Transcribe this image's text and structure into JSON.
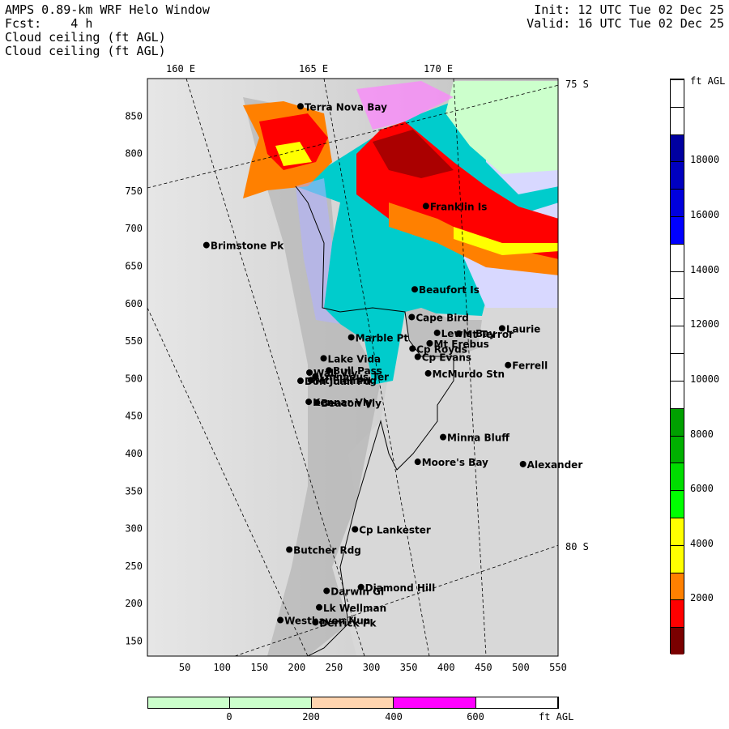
{
  "header": {
    "line1_left": "AMPS 0.89-km WRF Helo Window",
    "line2_left": "Fcst:    4 h",
    "line3_left": "Cloud ceiling (ft AGL)",
    "line4_left": "Cloud ceiling (ft AGL)",
    "line1_right": "Init: 12 UTC Tue 02 Dec 25",
    "line2_right": "Valid: 16 UTC Tue 02 Dec 25"
  },
  "lon_labels": [
    "160 E",
    "165 E",
    "170 E"
  ],
  "lat_labels": [
    "75 S",
    "80 S"
  ],
  "y_ticks": [
    "850",
    "800",
    "750",
    "700",
    "650",
    "600",
    "550",
    "500",
    "450",
    "400",
    "350",
    "300",
    "250",
    "200",
    "150"
  ],
  "x_ticks": [
    "50",
    "100",
    "150",
    "200",
    "250",
    "300",
    "350",
    "400",
    "450",
    "500",
    "550"
  ],
  "stations": [
    {
      "name": "Terra Nova Bay",
      "x": 205,
      "y": 863
    },
    {
      "name": "Franklin Is",
      "x": 373,
      "y": 730
    },
    {
      "name": "Brimstone Pk",
      "x": 79,
      "y": 678
    },
    {
      "name": "Beaufort Is",
      "x": 358,
      "y": 619
    },
    {
      "name": "Cape Bird",
      "x": 354,
      "y": 582
    },
    {
      "name": "Lewis Bay",
      "x": 388,
      "y": 561
    },
    {
      "name": "Laurie",
      "x": 475,
      "y": 567
    },
    {
      "name": "Mt Terror",
      "x": 417,
      "y": 560
    },
    {
      "name": "Marble Pt",
      "x": 273,
      "y": 555
    },
    {
      "name": "Cp Royds",
      "x": 355,
      "y": 540
    },
    {
      "name": "Mt Erebus",
      "x": 378,
      "y": 547
    },
    {
      "name": "Lake Vida",
      "x": 236,
      "y": 527
    },
    {
      "name": "Cp Evans",
      "x": 362,
      "y": 529
    },
    {
      "name": "Ferrell",
      "x": 483,
      "y": 518
    },
    {
      "name": "Wall Vly",
      "x": 217,
      "y": 508
    },
    {
      "name": "Bull Pass",
      "x": 243,
      "y": 511
    },
    {
      "name": "McMurdo Stn",
      "x": 376,
      "y": 507
    },
    {
      "name": "Don Juan Pd",
      "x": 205,
      "y": 497
    },
    {
      "name": "Mt Fleming",
      "x": 219,
      "y": 498
    },
    {
      "name": "Linnaeus Ter",
      "x": 225,
      "y": 503
    },
    {
      "name": "Kennar Vly",
      "x": 216,
      "y": 469
    },
    {
      "name": "Beacon Vly",
      "x": 227,
      "y": 468
    },
    {
      "name": "Minna Bluff",
      "x": 396,
      "y": 422
    },
    {
      "name": "Moore's Bay",
      "x": 362,
      "y": 389
    },
    {
      "name": "Alexander",
      "x": 503,
      "y": 386
    },
    {
      "name": "Cp Lankester",
      "x": 278,
      "y": 299
    },
    {
      "name": "Butcher Rdg",
      "x": 190,
      "y": 272
    },
    {
      "name": "Diamond Hill",
      "x": 286,
      "y": 222
    },
    {
      "name": "Darwin Gl",
      "x": 240,
      "y": 217
    },
    {
      "name": "Lk Wellman",
      "x": 230,
      "y": 195
    },
    {
      "name": "Westhaven Nun",
      "x": 178,
      "y": 178
    },
    {
      "name": "Derrick Pk",
      "x": 225,
      "y": 175
    }
  ],
  "colorbar": {
    "unit": "ft AGL",
    "ticks": [
      "2000",
      "4000",
      "6000",
      "8000",
      "10000",
      "12000",
      "14000",
      "16000",
      "18000"
    ],
    "colors": [
      "#7a0000",
      "#ff0000",
      "#ff8000",
      "#ffff00",
      "#ffff00",
      "#00ff00",
      "#00dd00",
      "#00b000",
      "#00a000",
      "#ffffff",
      "#ffffff",
      "#ffffff",
      "#ffffff",
      "#ffffff",
      "#ffffff",
      "#0000ff",
      "#0000dd",
      "#0000c0",
      "#0000a0",
      "#ffffff",
      "#ffffff"
    ]
  },
  "hbar": {
    "unit": "ft AGL",
    "ticks": [
      "0",
      "200",
      "400",
      "600"
    ],
    "colors": [
      "#ccffcc",
      "#ccffcc",
      "#ffd5b0",
      "#ff00ff",
      "#ffffff"
    ]
  }
}
